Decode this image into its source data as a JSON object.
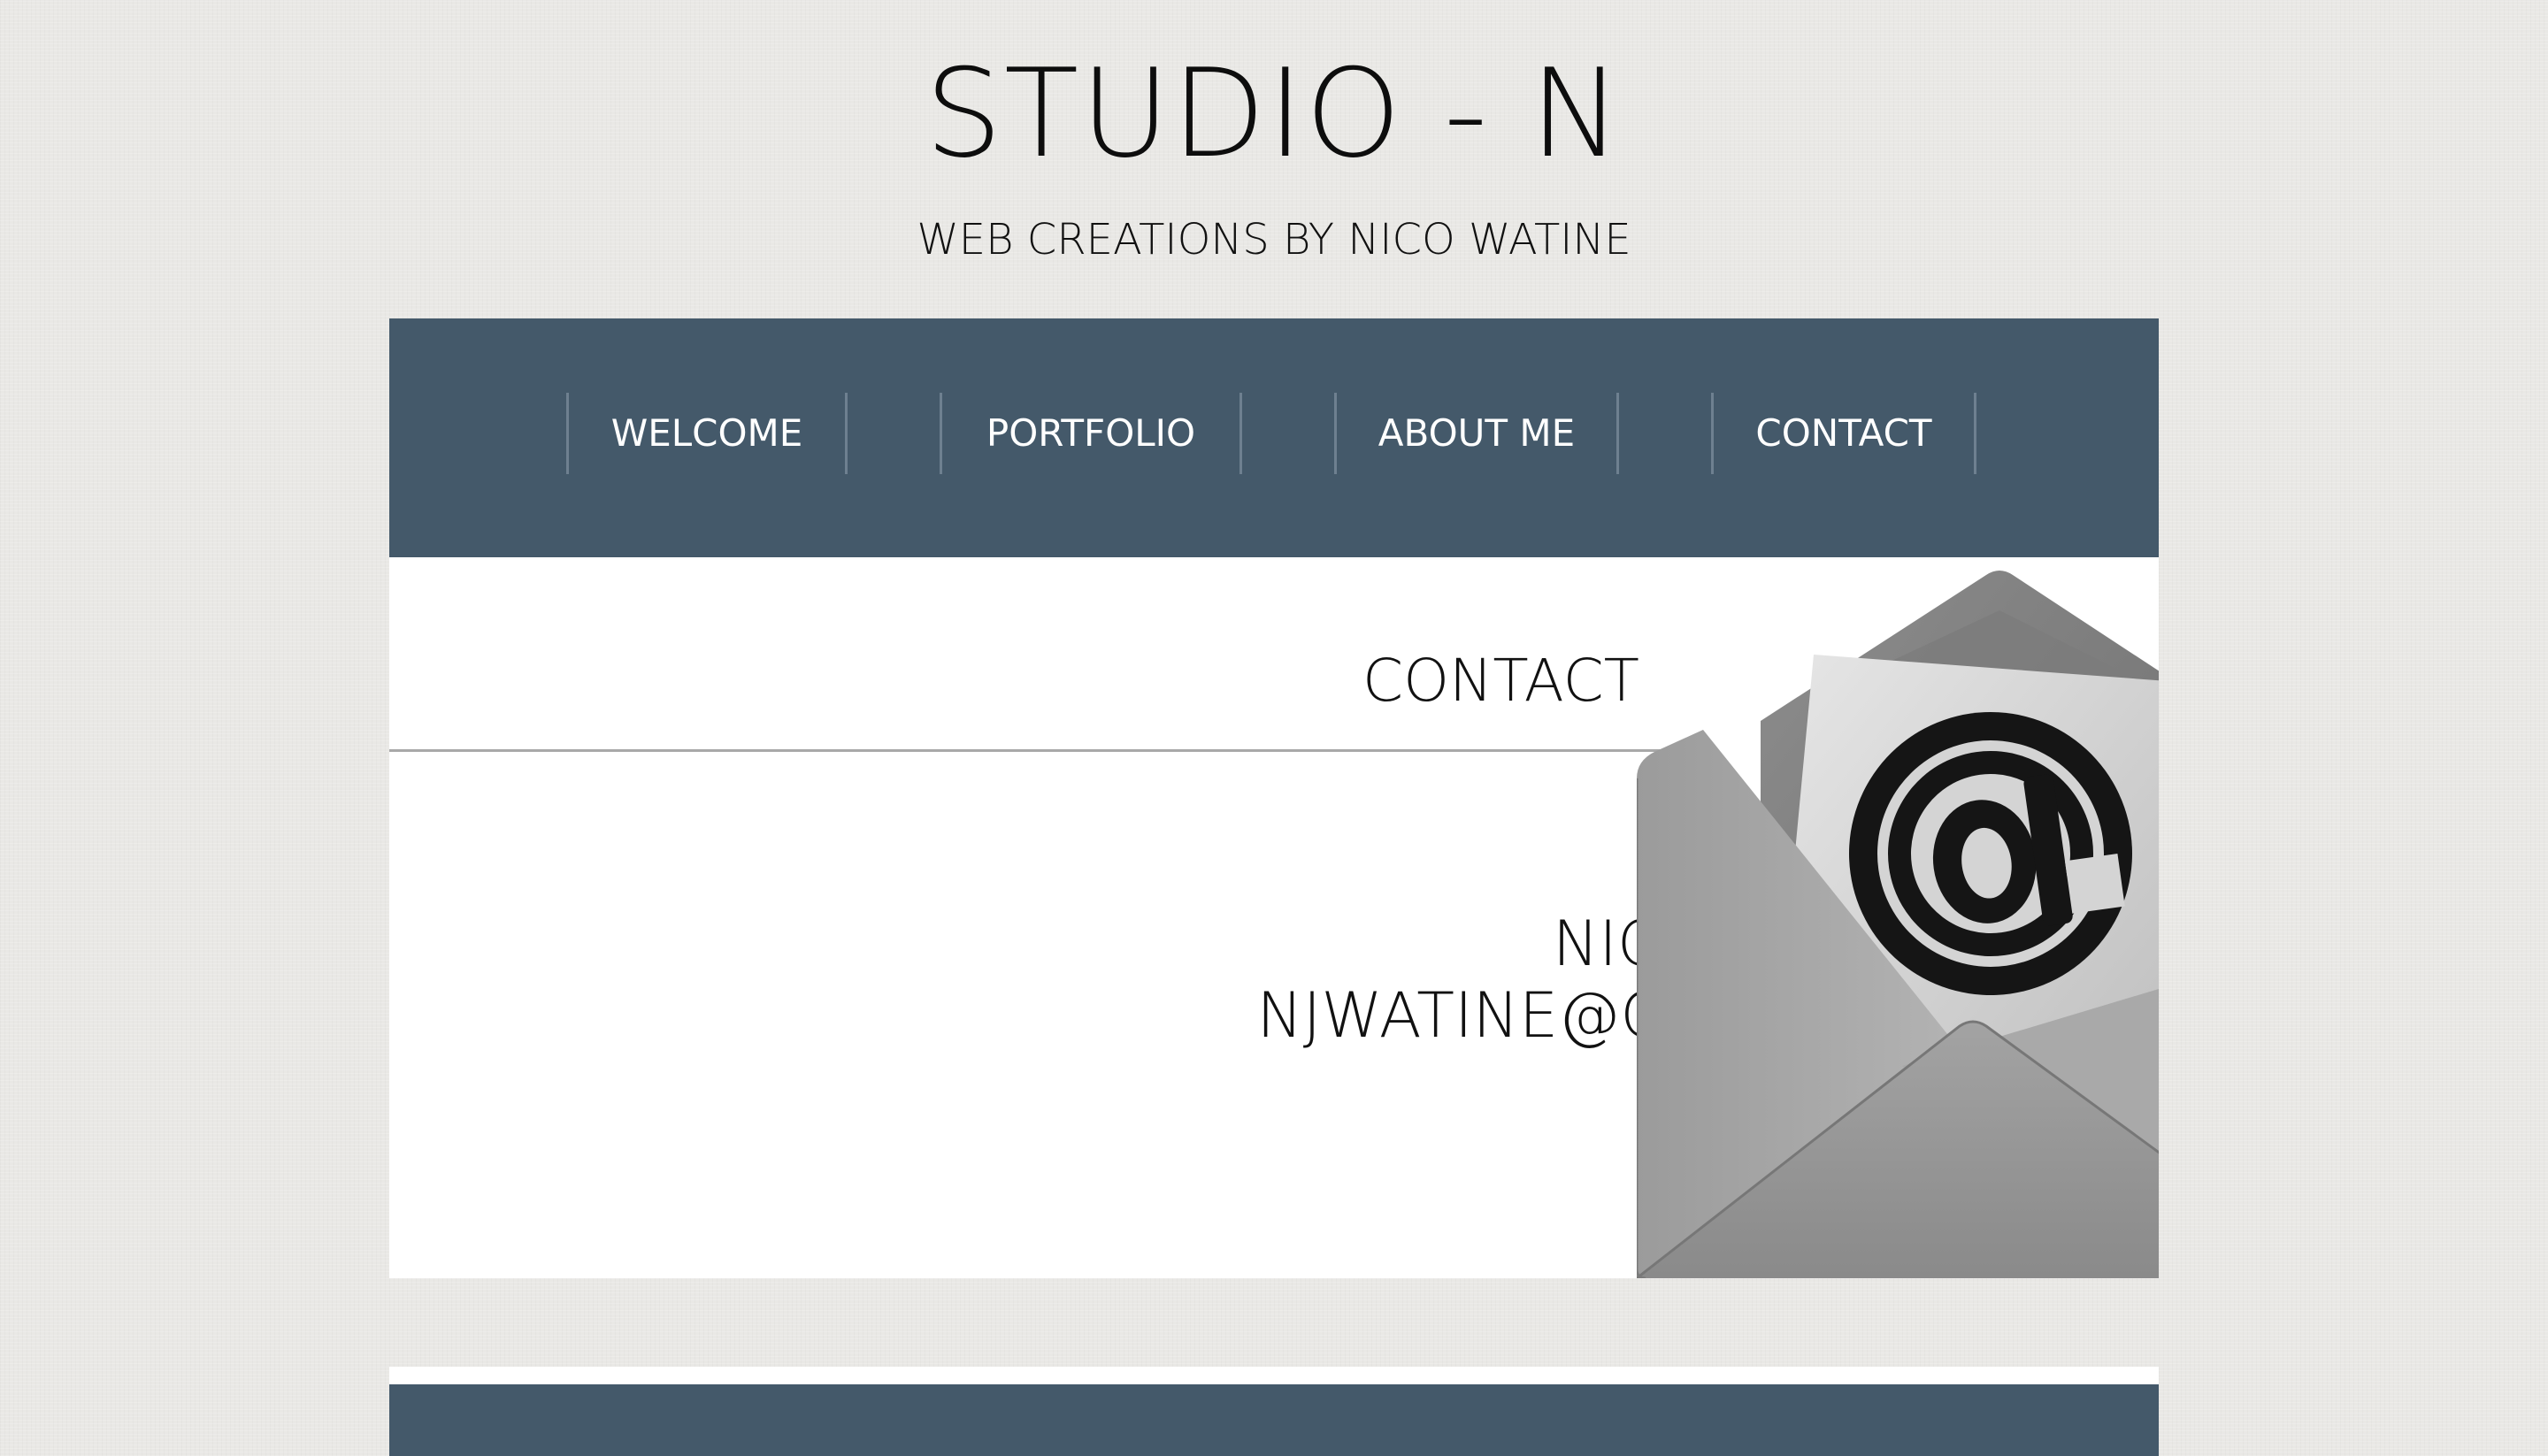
{
  "site": {
    "title": "STUDIO - N",
    "subtitle": "WEB CREATIONS BY NICO WATINE"
  },
  "nav": {
    "items": [
      {
        "label": "WELCOME"
      },
      {
        "label": "PORTFOLIO"
      },
      {
        "label": "ABOUT ME"
      },
      {
        "label": "CONTACT"
      }
    ]
  },
  "contact": {
    "heading": "CONTACT",
    "name": "NICO WATINE",
    "email": "NJWATINE@GMAIL.COM",
    "image_icon": "email-envelope-at-icon"
  },
  "colors": {
    "nav_background": "#44596a",
    "page_background": "#e9e8e5",
    "panel_background": "#ffffff",
    "text": "#111111",
    "nav_text": "#ffffff"
  }
}
